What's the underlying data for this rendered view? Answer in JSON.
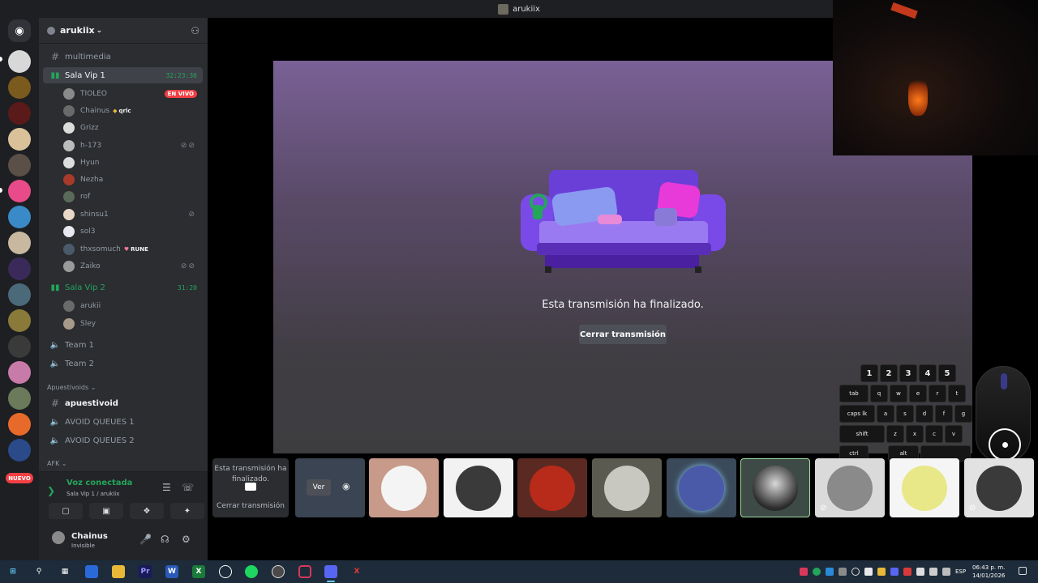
{
  "window": {
    "title": "arukiix"
  },
  "rail": {
    "badge_new": "NUEVO",
    "badge_count": "1"
  },
  "server": {
    "name": "arukiix"
  },
  "channels": {
    "multimedia": "multimedia",
    "vip1": {
      "name": "Sala Vip 1",
      "timer": "32:23:36"
    },
    "vip2": {
      "name": "Sala Vip 2",
      "timer": "31:20"
    },
    "team1": "Team 1",
    "team2": "Team 2",
    "category_apuestivoids": "Apuestivoids",
    "apuestivoid": "apuestivoid",
    "avoid1": "AVOID QUEUES 1",
    "avoid2": "AVOID QUEUES 2",
    "category_afk": "AFK"
  },
  "vip1_members": [
    {
      "name": "TIOLEO",
      "badge": "EN VIVO"
    },
    {
      "name": "Chainus",
      "tag": "qrlc"
    },
    {
      "name": "Grizz"
    },
    {
      "name": "h-173"
    },
    {
      "name": "Hyun"
    },
    {
      "name": "Nezha"
    },
    {
      "name": "rof"
    },
    {
      "name": "shinsu1"
    },
    {
      "name": "sol3"
    },
    {
      "name": "thxsomuch",
      "tag": "RUNE"
    },
    {
      "name": "Zaiko"
    }
  ],
  "vip2_members": [
    {
      "name": "arukii"
    },
    {
      "name": "Sley"
    }
  ],
  "voice_panel": {
    "status": "Voz conectada",
    "location": "Sala Vip 1 / arukiix"
  },
  "user": {
    "name": "Chainus",
    "status": "Invisible"
  },
  "stream": {
    "ended_message": "Esta transmisión ha finalizado.",
    "close_button": "Cerrar transmisión"
  },
  "tiles": {
    "ended_text": "Esta transmisión ha finalizado.",
    "close_text": "Cerrar transmisión",
    "watch": "Ver"
  },
  "keyboard": {
    "row1": [
      "1",
      "2",
      "3",
      "4",
      "5"
    ],
    "row2": [
      "tab",
      "q",
      "w",
      "e",
      "r",
      "t"
    ],
    "row3": [
      "caps lk",
      "a",
      "s",
      "d",
      "f",
      "g"
    ],
    "row4": [
      "shift",
      "z",
      "x",
      "c",
      "v"
    ],
    "row5": [
      "ctrl",
      "alt"
    ]
  },
  "taskbar": {
    "lang": "ESP",
    "time": "06:43 p. m.",
    "date": "14/01/2026"
  },
  "colors": {
    "accent_green": "#23a55a",
    "live_red": "#f23f43",
    "sidebar": "#2b2d31",
    "rail": "#1e1f22"
  }
}
